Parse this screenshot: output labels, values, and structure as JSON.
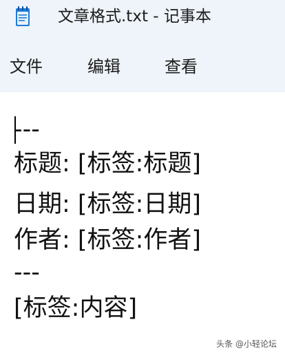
{
  "window": {
    "title": "文章格式.txt - 记事本"
  },
  "menu": {
    "file": "文件",
    "edit": "编辑",
    "view": "查看"
  },
  "document": {
    "lines": [
      "---",
      "标题: [标签:标题]",
      "日期: [标签:日期]",
      "作者: [标签:作者]",
      "---",
      "[标签:内容]"
    ]
  },
  "watermark": "头条 @小轻论坛",
  "colors": {
    "chrome": "#eef4f9",
    "icon_blue": "#1f7ad8",
    "text": "#1b1b1b"
  },
  "icons": {
    "app": "notepad-icon"
  }
}
